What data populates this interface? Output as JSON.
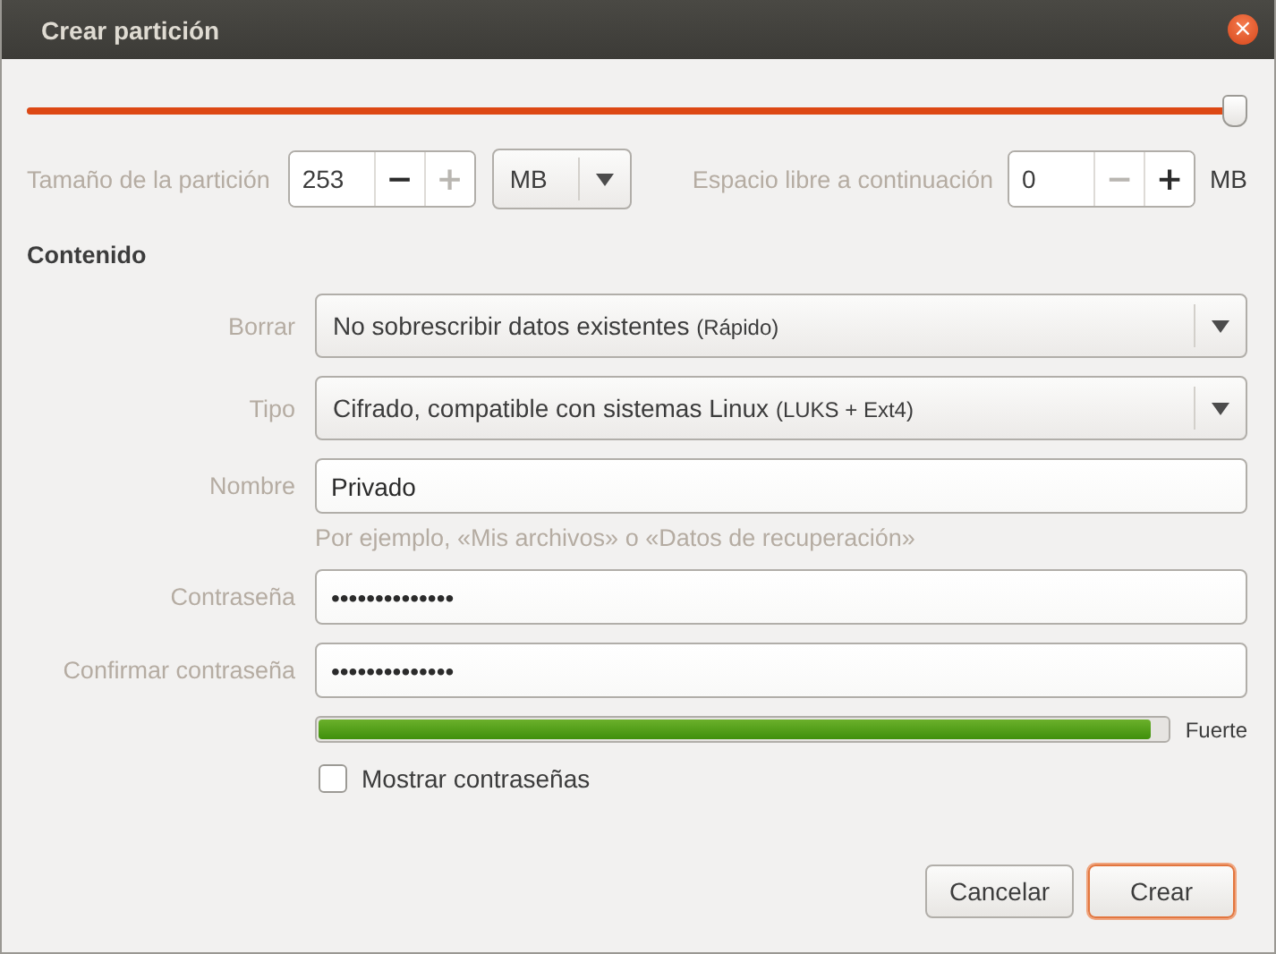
{
  "window": {
    "title": "Crear partición",
    "close": "×"
  },
  "slider": {
    "level": 1.0
  },
  "size": {
    "label": "Tamaño de la partición",
    "value": "253",
    "minus": "−",
    "plus": "+",
    "minus_disabled": false,
    "plus_disabled": true,
    "unit": "MB"
  },
  "free_space": {
    "label": "Espacio libre a continuación",
    "value": "0",
    "minus": "−",
    "plus": "+",
    "minus_disabled": true,
    "plus_disabled": false,
    "unit": "MB"
  },
  "section": "Contenido",
  "rows": [
    {
      "kind": "combo",
      "label": "Borrar",
      "value": "No sobrescribir datos existentes",
      "note": "(Rápido)"
    },
    {
      "kind": "combo",
      "label": "Tipo",
      "value": "Cifrado, compatible con sistemas Linux",
      "note": "(LUKS + Ext4)"
    },
    {
      "kind": "entry",
      "label": "Nombre",
      "value": "Privado",
      "hint": "Por ejemplo, «Mis archivos» o «Datos de recuperación»"
    },
    {
      "kind": "entry",
      "label": "Contraseña",
      "value": "••••••••••••••"
    },
    {
      "kind": "entry",
      "label": "Confirmar contraseña",
      "value": "••••••••••••••"
    }
  ],
  "strength": {
    "level": 0.98,
    "label": "Fuerte"
  },
  "show_passwords": {
    "label": "Mostrar contraseñas",
    "checked": false
  },
  "buttons": [
    {
      "label": "Cancelar",
      "default": false
    },
    {
      "label": "Crear",
      "default": true
    }
  ]
}
